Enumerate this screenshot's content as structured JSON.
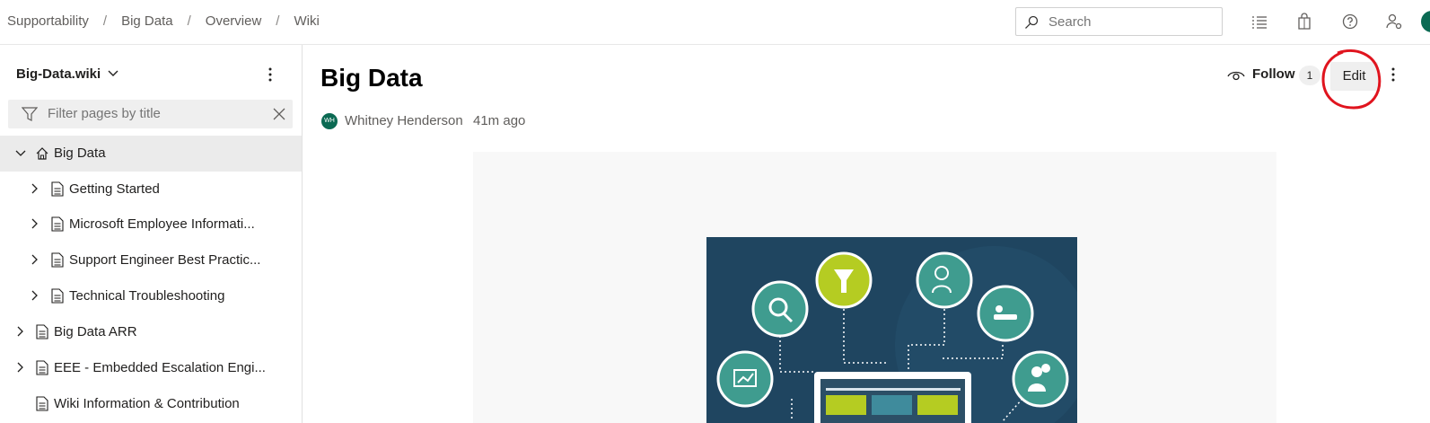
{
  "breadcrumb": [
    "Supportability",
    "Big Data",
    "Overview",
    "Wiki"
  ],
  "breadcrumb_separator": "/",
  "search": {
    "placeholder": "Search"
  },
  "topbar_icons": [
    "task-list-icon",
    "marketplace-bag-icon",
    "help-icon",
    "user-settings-icon",
    "user-avatar"
  ],
  "sidebar": {
    "wiki_name": "Big-Data.wiki",
    "filter_placeholder": "Filter pages by title",
    "items": [
      {
        "label": "Big Data",
        "level": 0,
        "expanded": true,
        "icon": "home-icon",
        "selected": true
      },
      {
        "label": "Getting Started",
        "level": 1,
        "expandable": true,
        "icon": "page-icon"
      },
      {
        "label": "Microsoft Employee Informati...",
        "level": 1,
        "expandable": true,
        "icon": "page-icon"
      },
      {
        "label": "Support Engineer Best Practic...",
        "level": 1,
        "expandable": true,
        "icon": "page-icon"
      },
      {
        "label": "Technical Troubleshooting",
        "level": 1,
        "expandable": true,
        "icon": "page-icon"
      },
      {
        "label": "Big Data ARR",
        "level": 0,
        "expandable": true,
        "icon": "page-icon"
      },
      {
        "label": "EEE - Embedded Escalation Engi...",
        "level": 0,
        "expandable": true,
        "icon": "page-icon"
      },
      {
        "label": "Wiki Information & Contribution",
        "level": 0,
        "expandable": false,
        "icon": "page-icon"
      }
    ]
  },
  "page": {
    "title": "Big Data",
    "author_initials": "WH",
    "author": "Whitney Henderson",
    "updated": "41m ago",
    "follow_label": "Follow",
    "follower_count": "1",
    "edit_label": "Edit"
  },
  "colors": {
    "accent_green": "#0b6a53",
    "illustration_bg": "#1f4560",
    "annotation_red": "#e0141e"
  }
}
